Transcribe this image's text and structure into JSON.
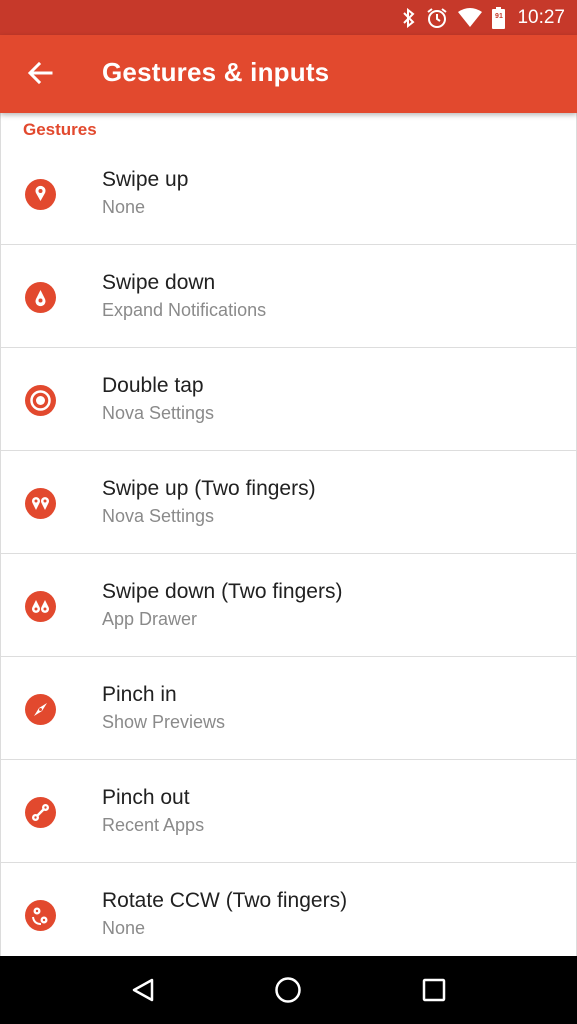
{
  "status_bar": {
    "time": "10:27",
    "battery_level": "91",
    "icons": [
      "bluetooth-icon",
      "alarm-icon",
      "wifi-icon",
      "battery-icon"
    ]
  },
  "app_bar": {
    "title": "Gestures & inputs",
    "back_icon": "arrow-back-icon",
    "color": "#e2492e"
  },
  "section": {
    "header": "Gestures",
    "accent": "#e2492e"
  },
  "items": [
    {
      "title": "Swipe up",
      "subtitle": "None",
      "icon": "swipe-up-icon"
    },
    {
      "title": "Swipe down",
      "subtitle": "Expand Notifications",
      "icon": "swipe-down-icon"
    },
    {
      "title": "Double tap",
      "subtitle": "Nova Settings",
      "icon": "double-tap-icon"
    },
    {
      "title": "Swipe up (Two fingers)",
      "subtitle": "Nova Settings",
      "icon": "two-finger-swipe-up-icon"
    },
    {
      "title": "Swipe down (Two fingers)",
      "subtitle": "App Drawer",
      "icon": "two-finger-swipe-down-icon"
    },
    {
      "title": "Pinch in",
      "subtitle": "Show Previews",
      "icon": "pinch-in-icon"
    },
    {
      "title": "Pinch out",
      "subtitle": "Recent Apps",
      "icon": "pinch-out-icon"
    },
    {
      "title": "Rotate CCW (Two fingers)",
      "subtitle": "None",
      "icon": "rotate-ccw-icon"
    }
  ],
  "nav_bar": {
    "back": "nav-back-icon",
    "home": "nav-home-icon",
    "recents": "nav-recents-icon"
  }
}
